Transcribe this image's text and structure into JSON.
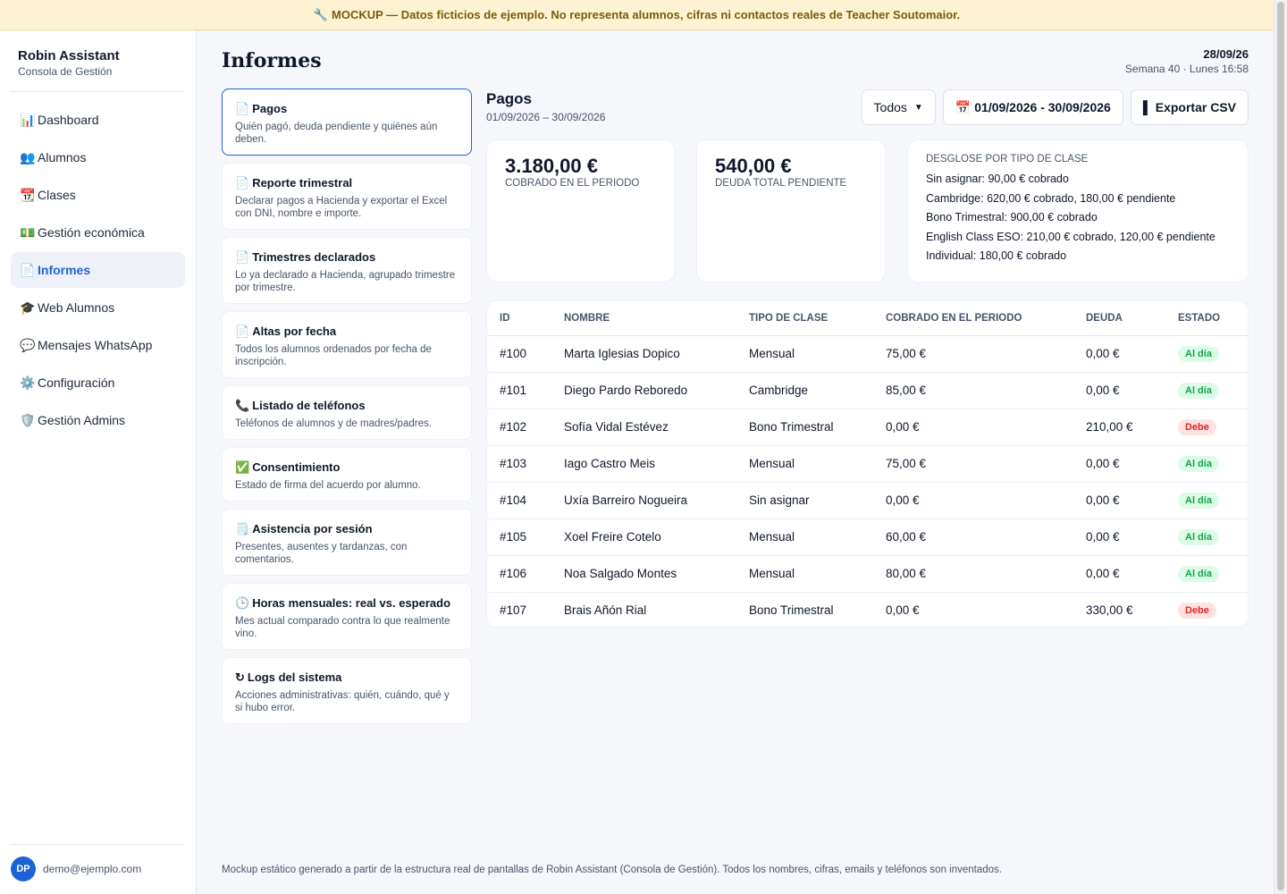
{
  "banner": {
    "icon": "🔧",
    "text": "MOCKUP — Datos ficticios de ejemplo. No representa alumnos, cifras ni contactos reales de Teacher Soutomaior."
  },
  "sidebar": {
    "app_name": "Robin Assistant",
    "app_subtitle": "Consola de Gestión",
    "items": [
      {
        "icon": "📊",
        "label": "Dashboard"
      },
      {
        "icon": "👥",
        "label": "Alumnos"
      },
      {
        "icon": "📆",
        "label": "Clases"
      },
      {
        "icon": "💵",
        "label": "Gestión económica"
      },
      {
        "icon": "📄",
        "label": "Informes",
        "active": true
      },
      {
        "icon": "🎓",
        "label": "Web Alumnos"
      },
      {
        "icon": "💬",
        "label": "Mensajes WhatsApp"
      },
      {
        "icon": "⚙️",
        "label": "Configuración"
      },
      {
        "icon": "🛡️",
        "label": "Gestión Admins"
      }
    ],
    "user": {
      "initials": "DP",
      "email": "demo@ejemplo.com"
    }
  },
  "header": {
    "title": "Informes",
    "date": "28/09/26",
    "week": "Semana 40 · Lunes 16:58"
  },
  "reports": [
    {
      "icon": "📄",
      "title": "Pagos",
      "desc": "Quién pagó, deuda pendiente y quiénes aún deben.",
      "active": true
    },
    {
      "icon": "📄",
      "title": "Reporte trimestral",
      "desc": "Declarar pagos a Hacienda y exportar el Excel con DNI, nombre e importe."
    },
    {
      "icon": "📄",
      "title": "Trimestres declarados",
      "desc": "Lo ya declarado a Hacienda, agrupado trimestre por trimestre."
    },
    {
      "icon": "📄",
      "title": "Altas por fecha",
      "desc": "Todos los alumnos ordenados por fecha de inscripción."
    },
    {
      "icon": "📞",
      "title": "Listado de teléfonos",
      "desc": "Teléfonos de alumnos y de madres/padres."
    },
    {
      "icon": "✅",
      "title": "Consentimiento",
      "desc": "Estado de firma del acuerdo por alumno."
    },
    {
      "icon": "🗒️",
      "title": "Asistencia por sesión",
      "desc": "Presentes, ausentes y tardanzas, con comentarios."
    },
    {
      "icon": "🕒",
      "title": "Horas mensuales: real vs. esperado",
      "desc": "Mes actual comparado contra lo que realmente vino."
    },
    {
      "icon": "↻",
      "title": "Logs del sistema",
      "desc": "Acciones administrativas: quién, cuándo, qué y si hubo error."
    }
  ],
  "section": {
    "title": "Pagos",
    "range": "01/09/2026 – 30/09/2026"
  },
  "toolbar": {
    "filter_value": "Todos",
    "date_icon": "📅",
    "date_range": "01/09/2026 - 30/09/2026",
    "export_icon": "▌",
    "export_label": "Exportar CSV"
  },
  "stats": [
    {
      "value": "3.180,00 €",
      "label": "Cobrado en el periodo"
    },
    {
      "value": "540,00 €",
      "label": "Deuda total pendiente"
    }
  ],
  "breakdown": {
    "title": "Desglose por tipo de clase",
    "rows": [
      "Sin asignar: 90,00 € cobrado",
      "Cambridge: 620,00 € cobrado, 180,00 € pendiente",
      "Bono Trimestral: 900,00 € cobrado",
      "English Class ESO: 210,00 € cobrado, 120,00 € pendiente",
      "Individual: 180,00 € cobrado"
    ]
  },
  "table": {
    "columns": [
      "ID",
      "Nombre",
      "Tipo de clase",
      "Cobrado en el periodo",
      "Deuda",
      "Estado"
    ],
    "rows": [
      {
        "id": "#100",
        "name": "Marta Iglesias Dopico",
        "type": "Mensual",
        "paid": "75,00 €",
        "debt": "0,00 €",
        "status": "Al día",
        "ok": true
      },
      {
        "id": "#101",
        "name": "Diego Pardo Reboredo",
        "type": "Cambridge",
        "paid": "85,00 €",
        "debt": "0,00 €",
        "status": "Al día",
        "ok": true
      },
      {
        "id": "#102",
        "name": "Sofía Vidal Estévez",
        "type": "Bono Trimestral",
        "paid": "0,00 €",
        "debt": "210,00 €",
        "status": "Debe",
        "ok": false
      },
      {
        "id": "#103",
        "name": "Iago Castro Meis",
        "type": "Mensual",
        "paid": "75,00 €",
        "debt": "0,00 €",
        "status": "Al día",
        "ok": true
      },
      {
        "id": "#104",
        "name": "Uxía Barreiro Nogueira",
        "type": "Sin asignar",
        "paid": "0,00 €",
        "debt": "0,00 €",
        "status": "Al día",
        "ok": true
      },
      {
        "id": "#105",
        "name": "Xoel Freire Cotelo",
        "type": "Mensual",
        "paid": "60,00 €",
        "debt": "0,00 €",
        "status": "Al día",
        "ok": true
      },
      {
        "id": "#106",
        "name": "Noa Salgado Montes",
        "type": "Mensual",
        "paid": "80,00 €",
        "debt": "0,00 €",
        "status": "Al día",
        "ok": true
      },
      {
        "id": "#107",
        "name": "Brais Añón Rial",
        "type": "Bono Trimestral",
        "paid": "0,00 €",
        "debt": "330,00 €",
        "status": "Debe",
        "ok": false
      }
    ]
  },
  "footer": "Mockup estático generado a partir de la estructura real de pantallas de Robin Assistant (Consola de Gestión). Todos los nombres, cifras, emails y teléfonos son inventados."
}
